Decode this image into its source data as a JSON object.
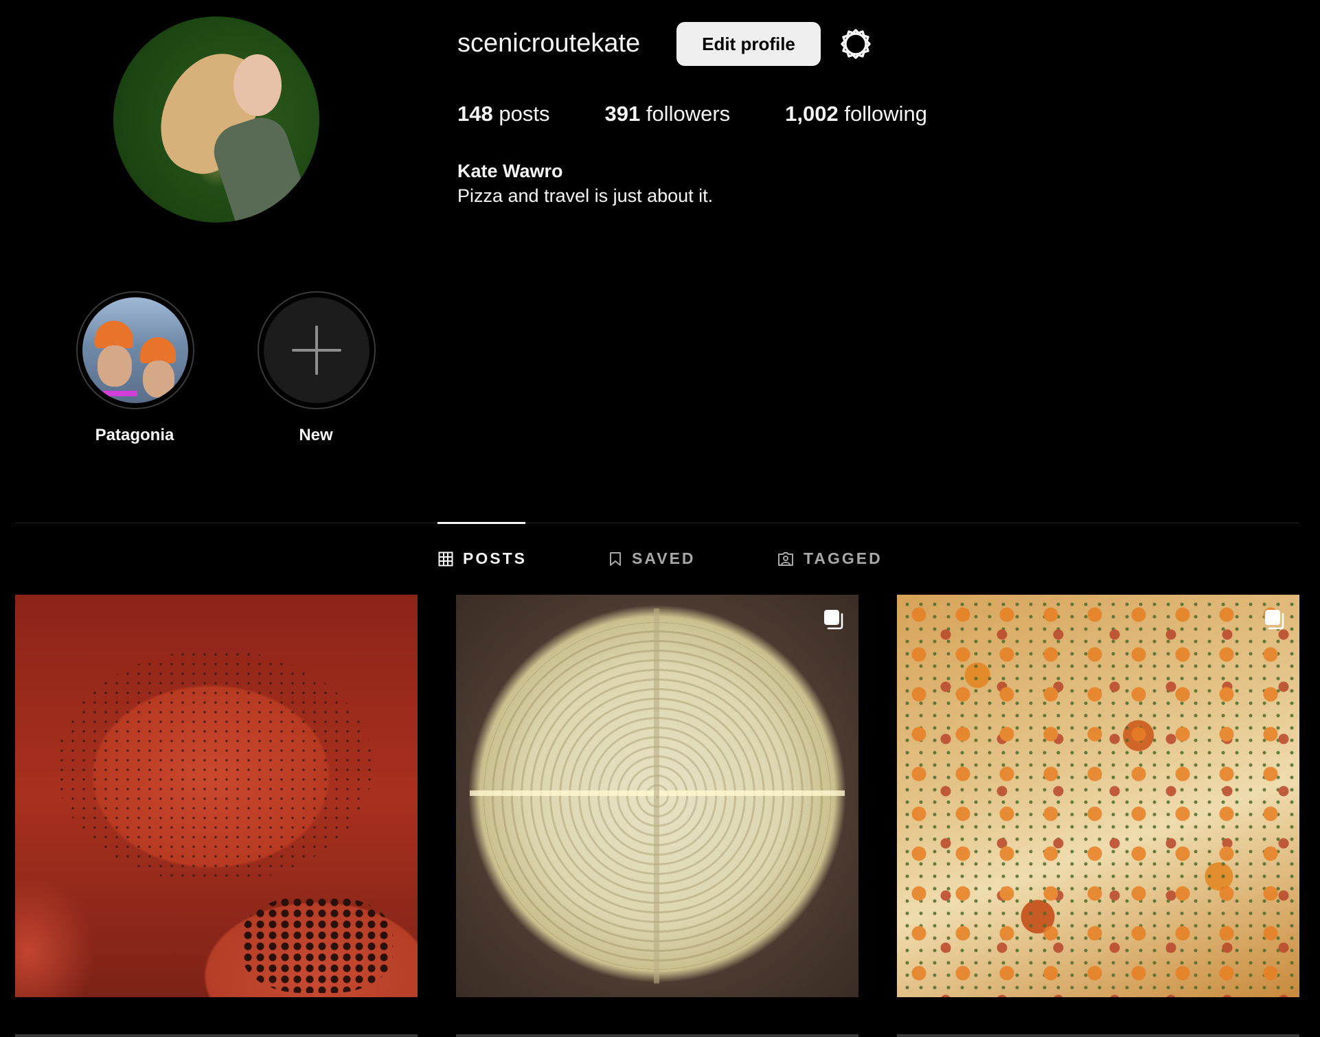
{
  "profile": {
    "username": "scenicroutekate",
    "edit_button": "Edit profile",
    "posts_count": "148",
    "posts_label": "posts",
    "followers_count": "391",
    "followers_label": "followers",
    "following_count": "1,002",
    "following_label": "following",
    "full_name": "Kate Wawro",
    "bio": "Pizza and travel is just about it."
  },
  "highlights": [
    {
      "label": "Patagonia"
    },
    {
      "label": "New"
    }
  ],
  "tabs": [
    {
      "label": "POSTS",
      "icon": "grid-icon",
      "active": true
    },
    {
      "label": "SAVED",
      "icon": "bookmark-icon",
      "active": false
    },
    {
      "label": "TAGGED",
      "icon": "tagged-icon",
      "active": false
    }
  ],
  "theme": {
    "background": "#000000",
    "text": "#f5f5f5",
    "muted": "#a8a8a8",
    "button_bg": "#efefef"
  }
}
